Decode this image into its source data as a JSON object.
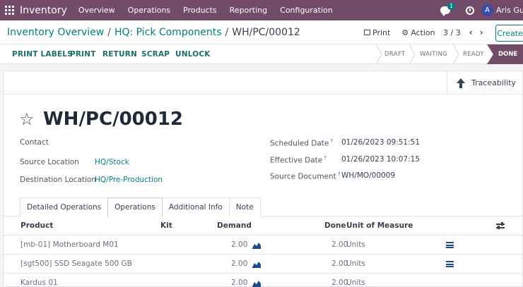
{
  "topbar": {
    "app_name": "Inventory",
    "menu": [
      "Overview",
      "Operations",
      "Products",
      "Reporting",
      "Configuration"
    ],
    "chat_count": "1",
    "user_initial": "A",
    "user_name": "Aris Gunta",
    "icons": [
      "grid-icon",
      "chat-icon",
      "clock-icon"
    ]
  },
  "breadcrumb": {
    "items": [
      "Inventory Overview",
      "HQ: Pick Components",
      "WH/PC/00012"
    ],
    "separator": "/",
    "print_label": "Print",
    "action_label": "Action",
    "pager": "3 / 3",
    "create_label": "Create"
  },
  "actions": [
    "PRINT LABELS",
    "PRINT",
    "RETURN",
    "SCRAP",
    "UNLOCK"
  ],
  "statusbar": {
    "steps": [
      "DRAFT",
      "WAITING",
      "READY",
      "DONE"
    ],
    "current": "DONE",
    "current_color": "#714b67"
  },
  "traceability_label": "Traceability",
  "record": {
    "title": "WH/PC/00012",
    "left_fields": [
      {
        "label": "Contact",
        "value": ""
      },
      {
        "label": "Source Location",
        "value": "HQ/Stock"
      },
      {
        "label": "Destination Location",
        "value": "HQ/Pre-Production"
      }
    ],
    "right_fields": [
      {
        "label": "Scheduled Date",
        "help": "?",
        "value": "01/26/2023 09:51:51"
      },
      {
        "label": "Effective Date",
        "help": "?",
        "value": "01/26/2023 10:07:15"
      },
      {
        "label": "Source Document",
        "help": "?",
        "value": "WH/MO/00009"
      }
    ]
  },
  "tabs": [
    "Detailed Operations",
    "Operations",
    "Additional Info",
    "Note"
  ],
  "active_tab": "Operations",
  "table": {
    "headers": [
      "Product",
      "Kit",
      "Demand",
      "Done",
      "Unit of Measure"
    ],
    "rows": [
      {
        "product": "[mb-01] Motherboard M01",
        "demand": "2.00",
        "done": "2.00",
        "uom": "Units",
        "details": true
      },
      {
        "product": "[sgt500] SSD Seagate 500 GB",
        "demand": "2.00",
        "done": "2.00",
        "uom": "Units",
        "details": true
      },
      {
        "product": "Kardus 01",
        "demand": "2.00",
        "done": "2.00",
        "uom": "Units",
        "details": false
      }
    ]
  },
  "colors": {
    "brand": "#714b67",
    "link": "#017e84",
    "action_text": "#1e6f6b"
  }
}
